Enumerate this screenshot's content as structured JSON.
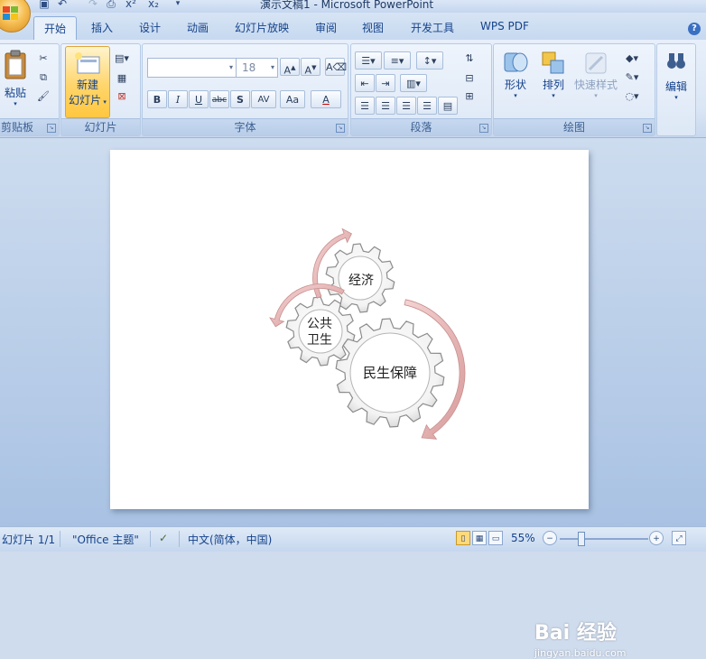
{
  "window": {
    "title": "演示文稿1 - Microsoft PowerPoint"
  },
  "tabs": [
    "开始",
    "插入",
    "设计",
    "动画",
    "幻灯片放映",
    "审阅",
    "视图",
    "开发工具",
    "WPS PDF"
  ],
  "active_tab": "开始",
  "ribbon": {
    "clipboard": {
      "label": "剪贴板",
      "paste": "粘贴"
    },
    "slides": {
      "label": "幻灯片",
      "new_slide_line1": "新建",
      "new_slide_line2": "幻灯片"
    },
    "font": {
      "label": "字体",
      "font_name": "",
      "font_size": "18",
      "bold": "B",
      "italic": "I",
      "underline": "U",
      "strike": "abc",
      "shadow": "S",
      "spacing": "AV",
      "case": "Aa",
      "color": "A"
    },
    "paragraph": {
      "label": "段落"
    },
    "drawing": {
      "label": "绘图",
      "shapes": "形状",
      "arrange": "排列",
      "quick_styles": "快速样式"
    },
    "editing": {
      "label": "编辑"
    }
  },
  "slide": {
    "gears": [
      {
        "label": "经济"
      },
      {
        "label": "公共\n卫生"
      },
      {
        "label": "民生保障"
      }
    ]
  },
  "status": {
    "slide_index": "幻灯片 1/1",
    "theme": "\"Office 主题\"",
    "language": "中文(简体，中国)",
    "zoom": "55%",
    "zoom_minus": "−",
    "zoom_plus": "+"
  },
  "watermark": {
    "text": "Bai 经验",
    "url": "jingyan.baidu.com"
  },
  "colors": {
    "ribbon": "#dbe6f5",
    "accent": "#15428b",
    "arrow": "#e8b0b0"
  }
}
